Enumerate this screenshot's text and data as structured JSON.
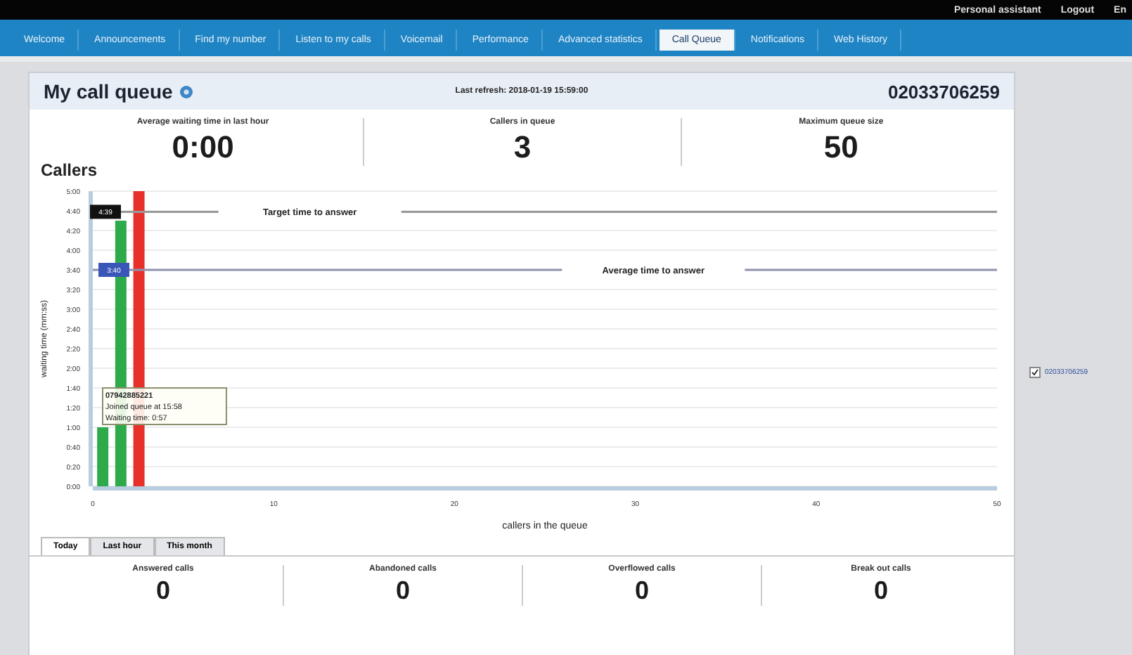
{
  "top_bar": {
    "links": [
      "Personal assistant",
      "Logout",
      "En"
    ]
  },
  "nav_tabs": [
    {
      "label": "Welcome",
      "selected": false
    },
    {
      "label": "Announcements",
      "selected": false
    },
    {
      "label": "Find my number",
      "selected": false
    },
    {
      "label": "Listen to my calls",
      "selected": false
    },
    {
      "label": "Voicemail",
      "selected": false
    },
    {
      "label": "Performance",
      "selected": false
    },
    {
      "label": "Advanced statistics",
      "selected": false
    },
    {
      "label": "Call Queue",
      "selected": true
    },
    {
      "label": "Notifications",
      "selected": false
    },
    {
      "label": "Web History",
      "selected": false
    }
  ],
  "panel": {
    "title": "My call queue",
    "last_refresh": "Last refresh: 2018-01-19 15:59:00",
    "number": "02033706259",
    "stats": [
      {
        "label": "Average waiting time in last hour",
        "value": "0:00"
      },
      {
        "label": "Callers in queue",
        "value": "3"
      },
      {
        "label": "Maximum queue size",
        "value": "50"
      }
    ],
    "chart_data": {
      "type": "bar",
      "title": "Callers",
      "xlabel": "callers in the queue",
      "ylabel": "waiting time (mm:ss)",
      "x": [
        1,
        2,
        3
      ],
      "grid": true,
      "series": [
        {
          "color": "#2eaa4a",
          "values": [
            60,
            270,
            null
          ]
        },
        {
          "color": "#e8302a",
          "values": [
            null,
            null,
            300
          ]
        }
      ],
      "xlim": [
        0,
        50
      ],
      "ylim": [
        0,
        300
      ],
      "xticks": [
        0,
        10,
        20,
        30,
        40,
        50
      ],
      "yticks": [
        {
          "value": 0,
          "label": "0:00"
        },
        {
          "value": 20,
          "label": "0:20"
        },
        {
          "value": 40,
          "label": "0:40"
        },
        {
          "value": 60,
          "label": "1:00"
        },
        {
          "value": 80,
          "label": "1:20"
        },
        {
          "value": 100,
          "label": "1:40"
        },
        {
          "value": 120,
          "label": "2:00"
        },
        {
          "value": 140,
          "label": "2:20"
        },
        {
          "value": 160,
          "label": "2:40"
        },
        {
          "value": 180,
          "label": "3:00"
        },
        {
          "value": 200,
          "label": "3:20"
        },
        {
          "value": 220,
          "label": "3:40"
        },
        {
          "value": 240,
          "label": "4:00"
        },
        {
          "value": 260,
          "label": "4:20"
        },
        {
          "value": 280,
          "label": "4:40"
        },
        {
          "value": 300,
          "label": "5:00"
        }
      ],
      "ref_lines": [
        {
          "axis": "y",
          "value": 279,
          "label": "Target time to answer"
        },
        {
          "axis": "y",
          "value": 220,
          "label": "Average time to answer"
        }
      ]
    },
    "line_badges": [
      {
        "text": "4:39",
        "color": "#111111"
      },
      {
        "text": "3:40",
        "color": "#3a56b8"
      }
    ],
    "tooltip": [
      "07942885221",
      "Joined queue at 15:58",
      "Waiting time: 0:57"
    ],
    "period_tabs": [
      {
        "label": "Today",
        "selected": true
      },
      {
        "label": "Last hour",
        "selected": false
      },
      {
        "label": "This month",
        "selected": false
      }
    ],
    "totals": [
      {
        "label": "Answered calls",
        "value": "0"
      },
      {
        "label": "Abandoned calls",
        "value": "0"
      },
      {
        "label": "Overflowed calls",
        "value": "0"
      },
      {
        "label": "Break out calls",
        "value": "0"
      }
    ]
  },
  "sidebar": {
    "checkbox": {
      "label": "02033706259",
      "checked": true
    }
  }
}
